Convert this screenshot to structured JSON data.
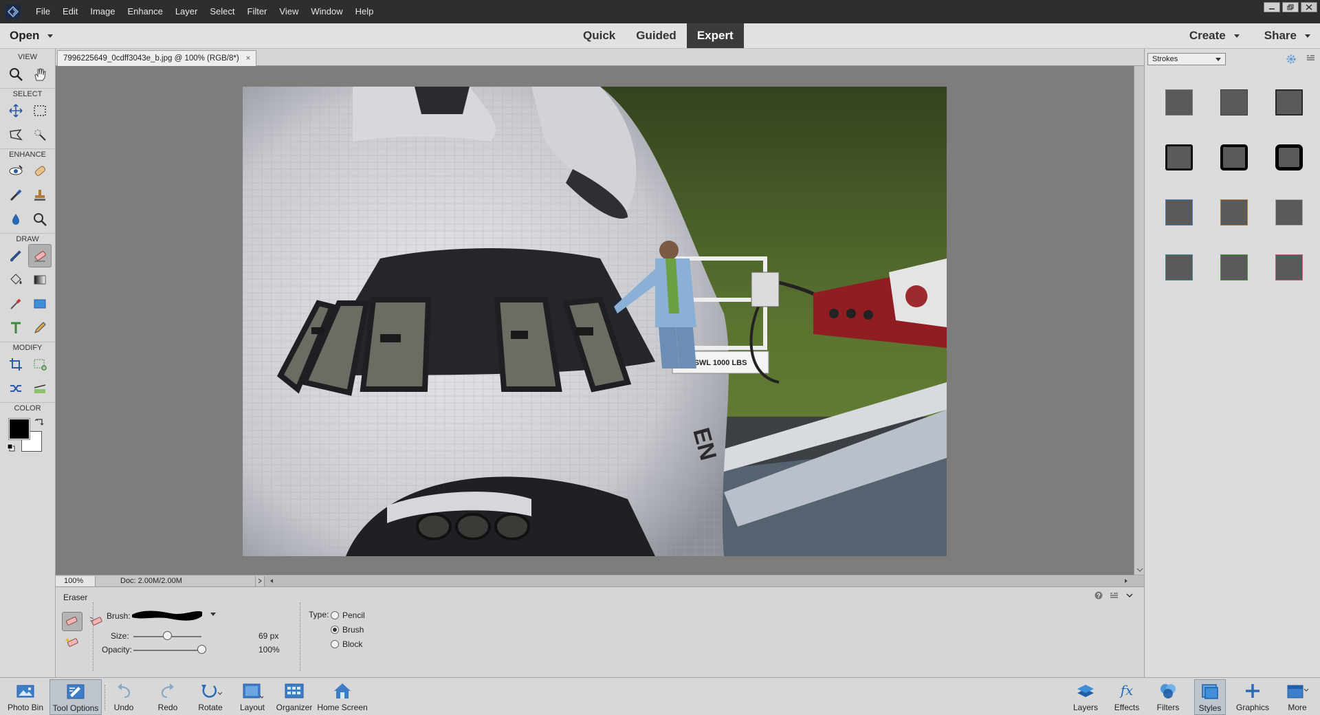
{
  "menu": {
    "items": [
      "File",
      "Edit",
      "Image",
      "Enhance",
      "Layer",
      "Select",
      "Filter",
      "View",
      "Window",
      "Help"
    ]
  },
  "modebar": {
    "open_label": "Open",
    "tabs": [
      "Quick",
      "Guided",
      "Expert"
    ],
    "active_tab": "Expert",
    "create_label": "Create",
    "share_label": "Share"
  },
  "toolbox": {
    "sections": {
      "view": "VIEW",
      "select": "SELECT",
      "enhance": "ENHANCE",
      "draw": "DRAW",
      "modify": "MODIFY",
      "color": "COLOR"
    },
    "icons": {
      "view": [
        "zoom-icon",
        "hand-icon"
      ],
      "select": [
        "move-icon",
        "marquee-icon",
        "lasso-icon",
        "quick-selection-icon"
      ],
      "enhance": [
        "red-eye-icon",
        "spot-healing-icon",
        "smart-brush-icon",
        "clone-stamp-icon",
        "blur-icon",
        "sponge-icon"
      ],
      "draw": [
        "brush-icon",
        "eraser-icon",
        "paint-bucket-icon",
        "gradient-icon",
        "eyedropper-icon",
        "shape-icon",
        "type-icon",
        "pencil-icon"
      ],
      "modify": [
        "crop-icon",
        "recompose-icon",
        "content-aware-move-icon",
        "straighten-icon"
      ]
    },
    "foreground_color": "#000000",
    "background_color": "#ffffff"
  },
  "document": {
    "tab_title": "7996225649_0cdff3043e_b.jpg @ 100% (RGB/8*)",
    "tab_close": "×",
    "zoom": "100%",
    "doc_info": "Doc: 2.00M/2.00M",
    "image": {
      "platform_sign": "SWL 1000 LBS",
      "hull_letters": "EN"
    }
  },
  "tool_options": {
    "tool_name": "Eraser",
    "brush_label": "Brush:",
    "size_label": "Size:",
    "size_value": "69 px",
    "size_fraction": 0.49,
    "opacity_label": "Opacity:",
    "opacity_value": "100%",
    "opacity_fraction": 1.0,
    "type_label": "Type:",
    "types": [
      "Pencil",
      "Brush",
      "Block"
    ],
    "selected_type": "Brush"
  },
  "right_panel": {
    "category": "Strokes",
    "styles": [
      {
        "name": "thin-gray-stroke",
        "stroke": "#7a7a7a"
      },
      {
        "name": "thin-dark-stroke",
        "stroke": "#3c3c3c"
      },
      {
        "name": "medium-dark-stroke",
        "stroke": "#2a2a2a"
      },
      {
        "name": "black-stroke",
        "stroke": "#111111"
      },
      {
        "name": "thick-black-stroke",
        "stroke": "#000000"
      },
      {
        "name": "heavy-black-stroke",
        "stroke": "#000000"
      },
      {
        "name": "blue-stroke",
        "stroke": "#4d7fc0"
      },
      {
        "name": "orange-stroke",
        "stroke": "#b07a3a"
      },
      {
        "name": "light-gray-stroke",
        "stroke": "#a0a0a0"
      },
      {
        "name": "teal-stroke",
        "stroke": "#3f8d9a"
      },
      {
        "name": "green-stroke",
        "stroke": "#4d9a3a"
      },
      {
        "name": "pink-stroke",
        "stroke": "#c0607f"
      }
    ]
  },
  "taskbar": {
    "left": [
      "Photo Bin",
      "Tool Options",
      "Undo",
      "Redo",
      "Rotate",
      "Layout",
      "Organizer",
      "Home Screen"
    ],
    "right": [
      "Layers",
      "Effects",
      "Filters",
      "Styles",
      "Graphics",
      "More"
    ],
    "active_left": "Tool Options",
    "active_right": "Styles"
  }
}
